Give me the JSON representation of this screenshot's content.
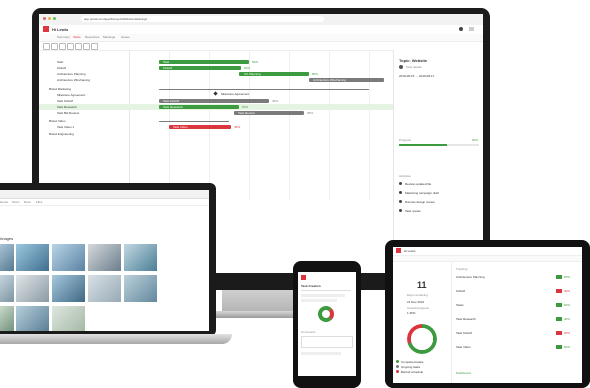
{
  "imac": {
    "app_title": "Hi Lewis",
    "url": "app.portal.com/app/#/project/Website-Redesign",
    "tabs": [
      "Summary",
      "Tasks",
      "Resources",
      "Meetings",
      "Issues"
    ],
    "active_tab": "Tasks",
    "rows": [
      {
        "label": "Start"
      },
      {
        "label": "Kickoff"
      },
      {
        "label": "Architecture Planning"
      },
      {
        "label": "Architecture Wireframing"
      },
      {
        "label": "Brand Marketing"
      },
      {
        "label": "Milestone Agreement"
      },
      {
        "label": "Task Kickoff"
      },
      {
        "label": "Task Research"
      },
      {
        "label": "Task Bid Review"
      },
      {
        "label": "Brand Video"
      },
      {
        "label": "Task Video 1"
      },
      {
        "label": "Brand Engineering"
      }
    ],
    "bar_labels": {
      "b1": "Task",
      "b2": "Kickoff",
      "b3": "UX Planning",
      "b4": "Architecture Wireframing",
      "b5": "Task Kickoff",
      "b6": "Task Research",
      "b7": "Milestone Agreement",
      "b8": "Task Bid",
      "b9": "Task Review",
      "b10": "Task Video"
    },
    "percents": {
      "p1": "50%",
      "p2": "60%",
      "p3": "80%",
      "p4": "40%",
      "p5": "50%",
      "p6": "35%",
      "p7": "45%",
      "p8": "80%"
    },
    "right_panel": {
      "title": "Topic: Website",
      "subtitle": "Task details",
      "date_range": "2019-08-15 → 2019-08-17",
      "progress_label": "Progress",
      "progress_value": "60%",
      "progress_fraction": 0.6,
      "activity_label": "Activities",
      "activities": [
        "Review updated file",
        "Marketing campaign draft",
        "Discuss design review",
        "Task review"
      ]
    }
  },
  "laptop": {
    "title": "Images",
    "nav": [
      "Home",
      "Team",
      "Docs",
      "Files"
    ]
  },
  "phone": {
    "title": "Task Creation",
    "section": "Comments"
  },
  "tablet": {
    "app_title": "Hi Lewis",
    "big_number": "11",
    "big_label": "Days remaining",
    "date": "21 Dec 2019",
    "metric1_label": "Overall progress",
    "metric1_value": "1.35%",
    "list_header": "Tracking",
    "items": [
      {
        "name": "Architecture Planning",
        "pct": "50%"
      },
      {
        "name": "Kickoff",
        "pct": "40%"
      },
      {
        "name": "Tasks",
        "pct": "60%"
      },
      {
        "name": "Task Research",
        "pct": "40%"
      },
      {
        "name": "Task Kickoff",
        "pct": "30%"
      },
      {
        "name": "Task Video",
        "pct": "90%"
      }
    ],
    "legend": [
      "Completed tasks",
      "Ongoing tasks",
      "Behind schedule"
    ],
    "footer": "Dashboard",
    "donut_fractions": {
      "green": 0.7,
      "red": 0.3
    }
  },
  "colors": {
    "accent": "#e0343c",
    "green": "#3d9b3f",
    "gray": "#7b7b7b",
    "dark": "#1b1b1b"
  }
}
